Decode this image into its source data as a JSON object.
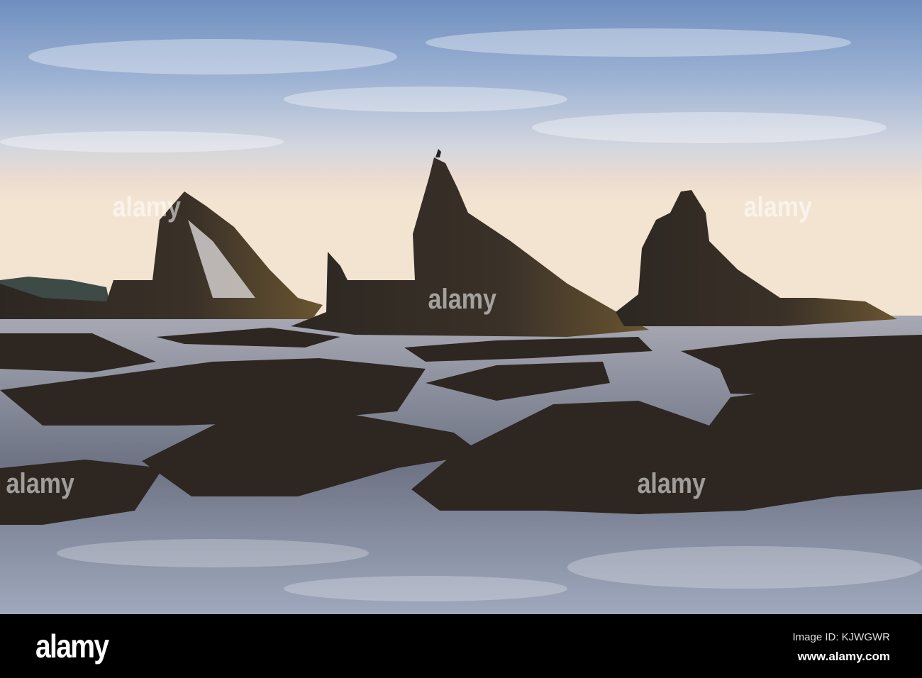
{
  "photo": {
    "subject": "sea-stacks-tidepools-sunset"
  },
  "watermark": {
    "text": "alamy"
  },
  "footer": {
    "logo": "alamy",
    "image_id": "Image ID: KJWGWR",
    "url": "www.alamy.com"
  }
}
